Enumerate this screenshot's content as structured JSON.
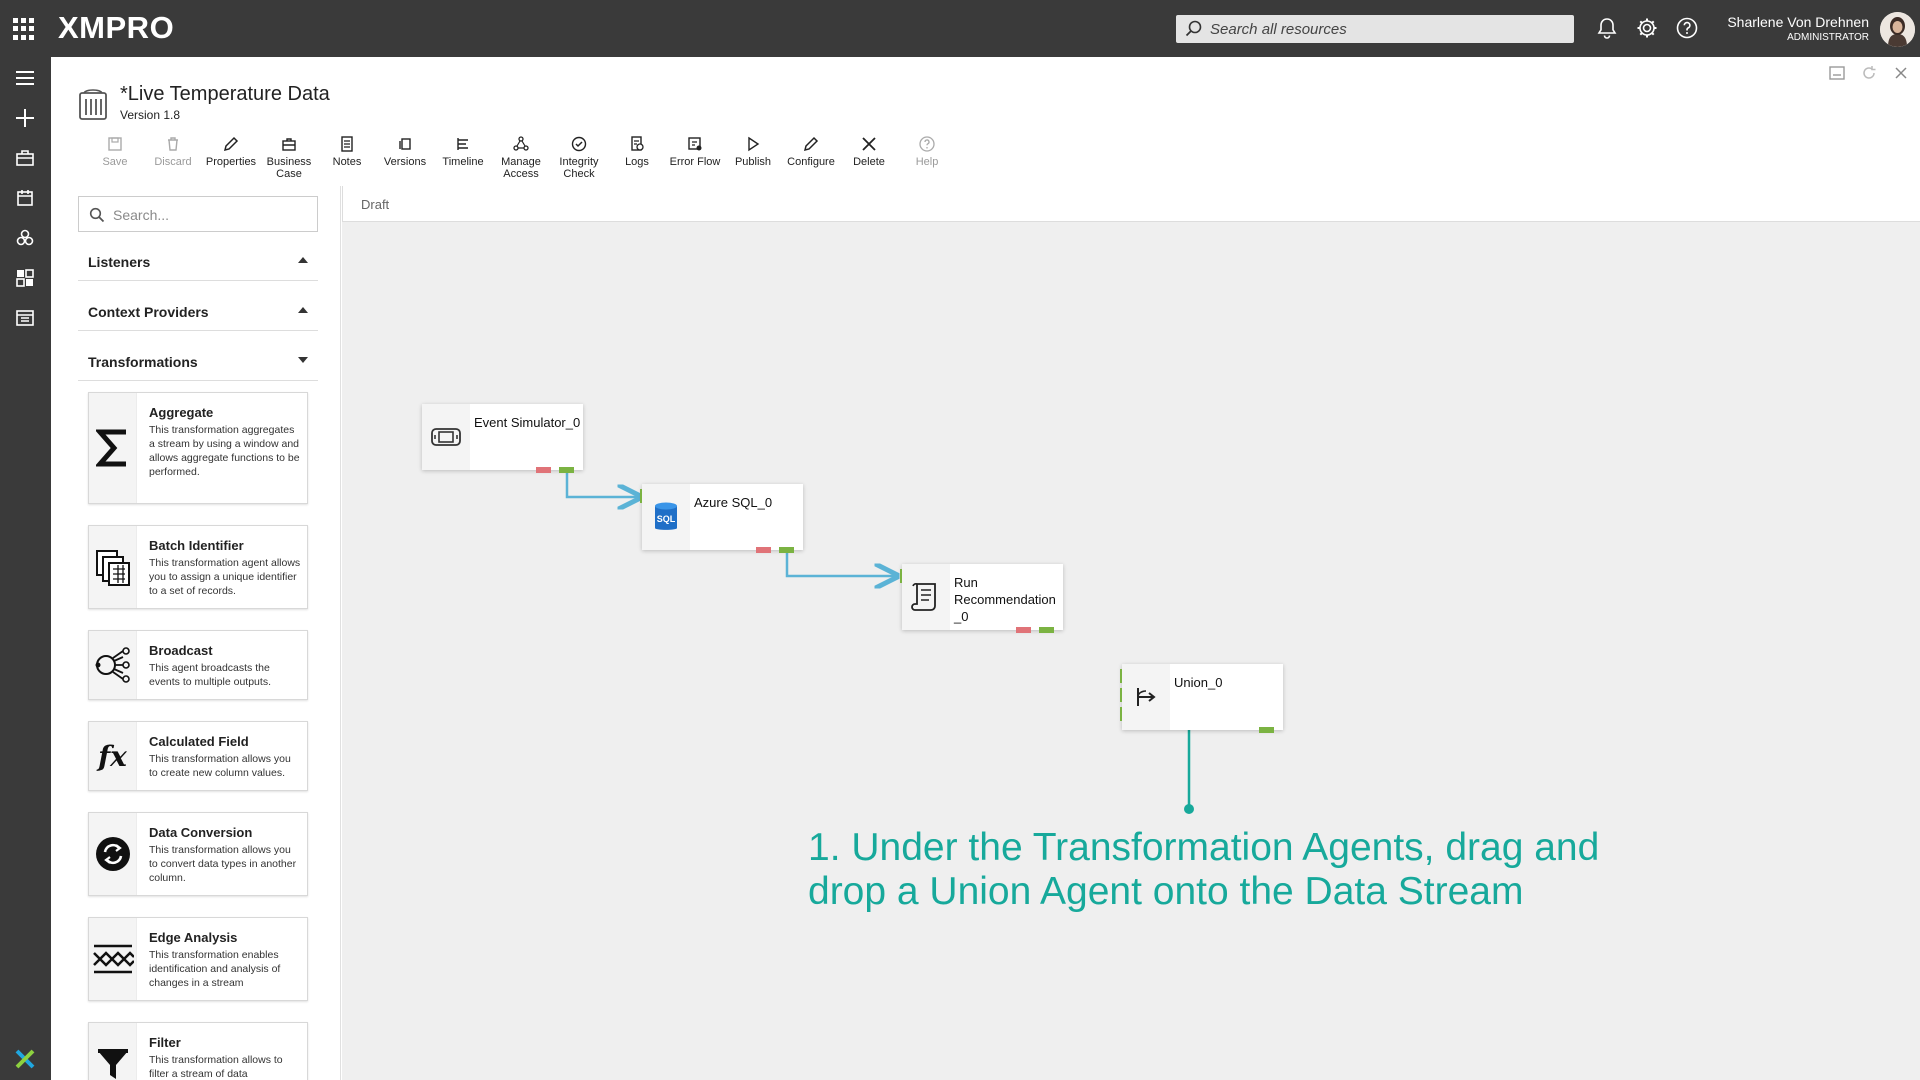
{
  "app": {
    "logo": "XMPRO",
    "search_placeholder": "Search all resources",
    "user_name": "Sharlene Von Drehnen",
    "user_role": "ADMINISTRATOR",
    "accent_color": "#17a99b"
  },
  "document": {
    "title": "*Live Temperature Data",
    "version": "Version 1.8"
  },
  "toolbar": [
    {
      "label": "Save",
      "icon": "save-icon",
      "disabled": true
    },
    {
      "label": "Discard",
      "icon": "trash-icon",
      "disabled": true
    },
    {
      "label": "Properties",
      "icon": "pencil-icon",
      "disabled": false
    },
    {
      "label": "Business Case",
      "icon": "briefcase-icon",
      "disabled": false
    },
    {
      "label": "Notes",
      "icon": "notes-icon",
      "disabled": false
    },
    {
      "label": "Versions",
      "icon": "versions-icon",
      "disabled": false
    },
    {
      "label": "Timeline",
      "icon": "timeline-icon",
      "disabled": false
    },
    {
      "label": "Manage Access",
      "icon": "share-icon",
      "disabled": false
    },
    {
      "label": "Integrity Check",
      "icon": "check-circle-icon",
      "disabled": false
    },
    {
      "label": "Logs",
      "icon": "logs-icon",
      "disabled": false
    },
    {
      "label": "Error Flow",
      "icon": "error-flow-icon",
      "disabled": false
    },
    {
      "label": "Publish",
      "icon": "play-icon",
      "disabled": false
    },
    {
      "label": "Configure",
      "icon": "pencil-icon",
      "disabled": false
    },
    {
      "label": "Delete",
      "icon": "close-icon",
      "disabled": false
    },
    {
      "label": "Help",
      "icon": "help-icon",
      "disabled": true
    }
  ],
  "sidebar": {
    "search_placeholder": "Search...",
    "sections": [
      {
        "title": "Listeners",
        "expanded": false
      },
      {
        "title": "Context Providers",
        "expanded": false
      },
      {
        "title": "Transformations",
        "expanded": true
      }
    ],
    "agents": [
      {
        "name": "Aggregate",
        "icon": "sigma-icon",
        "description": "This transformation aggregates a stream by using a window and allows aggregate functions to be performed."
      },
      {
        "name": "Batch Identifier",
        "icon": "batch-icon",
        "description": "This transformation agent allows you to assign a unique identifier to a set of records."
      },
      {
        "name": "Broadcast",
        "icon": "broadcast-icon",
        "description": "This agent broadcasts the events to multiple outputs."
      },
      {
        "name": "Calculated Field",
        "icon": "function-icon",
        "description": "This transformation allows you to create new column values."
      },
      {
        "name": "Data Conversion",
        "icon": "convert-icon",
        "description": "This transformation allows you to convert data types in another column."
      },
      {
        "name": "Edge Analysis",
        "icon": "edge-analysis-icon",
        "description": "This transformation enables identification and analysis of changes in a stream"
      },
      {
        "name": "Filter",
        "icon": "filter-icon",
        "description": "This transformation allows to filter a stream of data"
      }
    ]
  },
  "canvas": {
    "status": "Draft",
    "nodes": [
      {
        "label": "Event Simulator_0",
        "icon": "simulator-icon"
      },
      {
        "label": "Azure SQL_0",
        "icon": "sql-icon",
        "icon_text": "SQL"
      },
      {
        "label": "Run Recommendation _0",
        "icon": "script-icon"
      },
      {
        "label": "Union_0",
        "icon": "union-icon"
      }
    ]
  },
  "annotation": {
    "line1": "1. Under the Transformation Agents, drag and",
    "line2": "drop a Union Agent onto the Data Stream"
  }
}
